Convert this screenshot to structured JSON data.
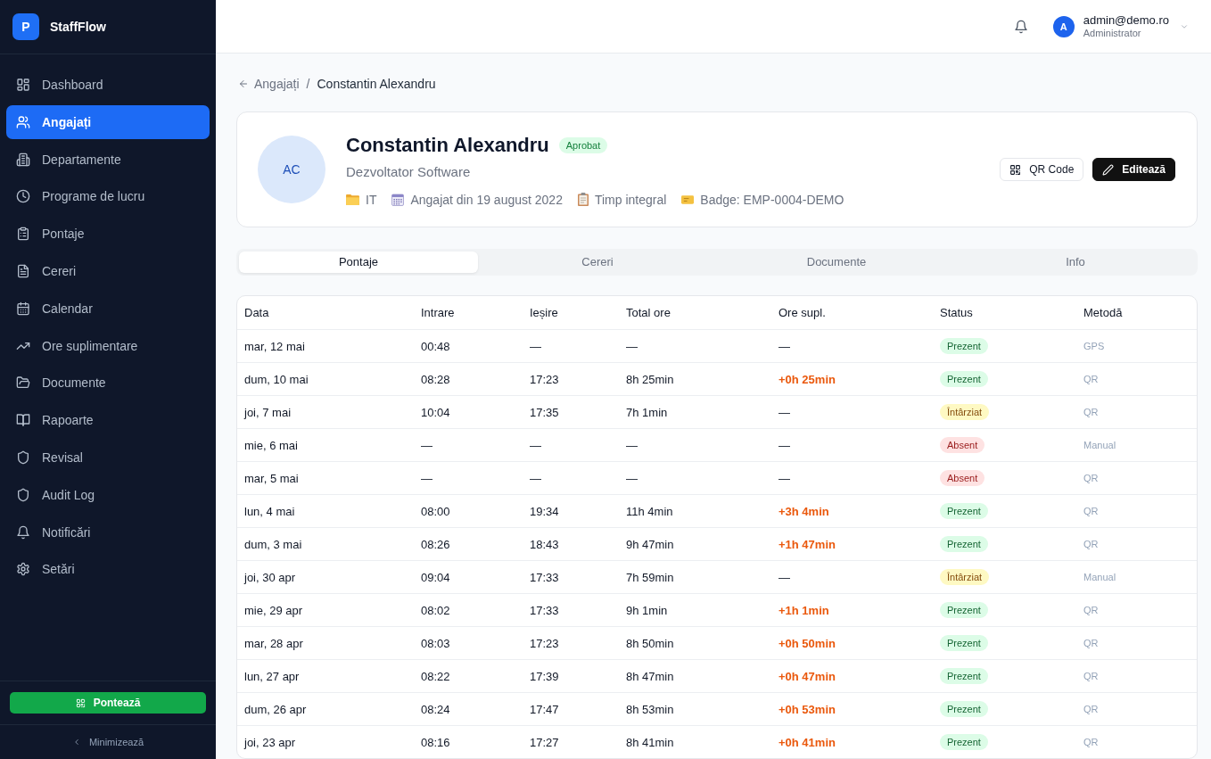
{
  "sidebar": {
    "brand": {
      "initial": "P",
      "name": "StaffFlow"
    },
    "items": [
      {
        "label": "Dashboard",
        "selected": false
      },
      {
        "label": "Angajați",
        "selected": true
      },
      {
        "label": "Departamente",
        "selected": false
      },
      {
        "label": "Programe de lucru",
        "selected": false
      },
      {
        "label": "Pontaje",
        "selected": false
      },
      {
        "label": "Cereri",
        "selected": false
      },
      {
        "label": "Calendar",
        "selected": false
      },
      {
        "label": "Ore suplimentare",
        "selected": false
      },
      {
        "label": "Documente",
        "selected": false
      },
      {
        "label": "Rapoarte",
        "selected": false
      },
      {
        "label": "Revisal",
        "selected": false
      },
      {
        "label": "Audit Log",
        "selected": false
      },
      {
        "label": "Notificări",
        "selected": false
      },
      {
        "label": "Setări",
        "selected": false
      }
    ],
    "clock_button": "Pontează",
    "collapse": "Minimizează"
  },
  "header": {
    "user": {
      "initial": "A",
      "email": "admin@demo.ro",
      "role": "Administrator"
    }
  },
  "breadcrumb": {
    "parent": "Angajați",
    "separator": "/",
    "current": "Constantin Alexandru"
  },
  "profile": {
    "initials": "AC",
    "name": "Constantin Alexandru",
    "badge": "Aprobat",
    "title": "Dezvoltator Software",
    "details": [
      "IT",
      "Angajat din 19 august 2022",
      "Timp integral",
      "Badge: EMP-0004-DEMO"
    ],
    "buttons": [
      {
        "label": "QR Code",
        "kind": "outline"
      },
      {
        "label": "Editează",
        "kind": "primary"
      }
    ]
  },
  "tabs": [
    {
      "label": "Pontaje",
      "selected": true
    },
    {
      "label": "Cereri",
      "selected": false
    },
    {
      "label": "Documente",
      "selected": false
    },
    {
      "label": "Info",
      "selected": false
    }
  ],
  "table": {
    "columns": [
      "Data",
      "Intrare",
      "Ieșire",
      "Total ore",
      "Ore supl.",
      "Status",
      "Metodă"
    ],
    "rows": [
      {
        "date": "mar, 12 mai",
        "clock_in": "00:48",
        "clock_out": "—",
        "total": "—",
        "overtime": {
          "text": "—",
          "highlight": false
        },
        "status": {
          "label": "Prezent",
          "kind": "present"
        },
        "method": "GPS"
      },
      {
        "date": "dum, 10 mai",
        "clock_in": "08:28",
        "clock_out": "17:23",
        "total": "8h 25min",
        "overtime": {
          "text": "+0h 25min",
          "highlight": true
        },
        "status": {
          "label": "Prezent",
          "kind": "present"
        },
        "method": "QR"
      },
      {
        "date": "joi, 7 mai",
        "clock_in": "10:04",
        "clock_out": "17:35",
        "total": "7h 1min",
        "overtime": {
          "text": "—",
          "highlight": false
        },
        "status": {
          "label": "Întârziat",
          "kind": "late"
        },
        "method": "QR"
      },
      {
        "date": "mie, 6 mai",
        "clock_in": "—",
        "clock_out": "—",
        "total": "—",
        "overtime": {
          "text": "—",
          "highlight": false
        },
        "status": {
          "label": "Absent",
          "kind": "absent"
        },
        "method": "Manual"
      },
      {
        "date": "mar, 5 mai",
        "clock_in": "—",
        "clock_out": "—",
        "total": "—",
        "overtime": {
          "text": "—",
          "highlight": false
        },
        "status": {
          "label": "Absent",
          "kind": "absent"
        },
        "method": "QR"
      },
      {
        "date": "lun, 4 mai",
        "clock_in": "08:00",
        "clock_out": "19:34",
        "total": "11h 4min",
        "overtime": {
          "text": "+3h 4min",
          "highlight": true
        },
        "status": {
          "label": "Prezent",
          "kind": "present"
        },
        "method": "QR"
      },
      {
        "date": "dum, 3 mai",
        "clock_in": "08:26",
        "clock_out": "18:43",
        "total": "9h 47min",
        "overtime": {
          "text": "+1h 47min",
          "highlight": true
        },
        "status": {
          "label": "Prezent",
          "kind": "present"
        },
        "method": "QR"
      },
      {
        "date": "joi, 30 apr",
        "clock_in": "09:04",
        "clock_out": "17:33",
        "total": "7h 59min",
        "overtime": {
          "text": "—",
          "highlight": false
        },
        "status": {
          "label": "Întârziat",
          "kind": "late"
        },
        "method": "Manual"
      },
      {
        "date": "mie, 29 apr",
        "clock_in": "08:02",
        "clock_out": "17:33",
        "total": "9h 1min",
        "overtime": {
          "text": "+1h 1min",
          "highlight": true
        },
        "status": {
          "label": "Prezent",
          "kind": "present"
        },
        "method": "QR"
      },
      {
        "date": "mar, 28 apr",
        "clock_in": "08:03",
        "clock_out": "17:23",
        "total": "8h 50min",
        "overtime": {
          "text": "+0h 50min",
          "highlight": true
        },
        "status": {
          "label": "Prezent",
          "kind": "present"
        },
        "method": "QR"
      },
      {
        "date": "lun, 27 apr",
        "clock_in": "08:22",
        "clock_out": "17:39",
        "total": "8h 47min",
        "overtime": {
          "text": "+0h 47min",
          "highlight": true
        },
        "status": {
          "label": "Prezent",
          "kind": "present"
        },
        "method": "QR"
      },
      {
        "date": "dum, 26 apr",
        "clock_in": "08:24",
        "clock_out": "17:47",
        "total": "8h 53min",
        "overtime": {
          "text": "+0h 53min",
          "highlight": true
        },
        "status": {
          "label": "Prezent",
          "kind": "present"
        },
        "method": "QR"
      },
      {
        "date": "joi, 23 apr",
        "clock_in": "08:16",
        "clock_out": "17:27",
        "total": "8h 41min",
        "overtime": {
          "text": "+0h 41min",
          "highlight": true
        },
        "status": {
          "label": "Prezent",
          "kind": "present"
        },
        "method": "QR"
      }
    ]
  }
}
